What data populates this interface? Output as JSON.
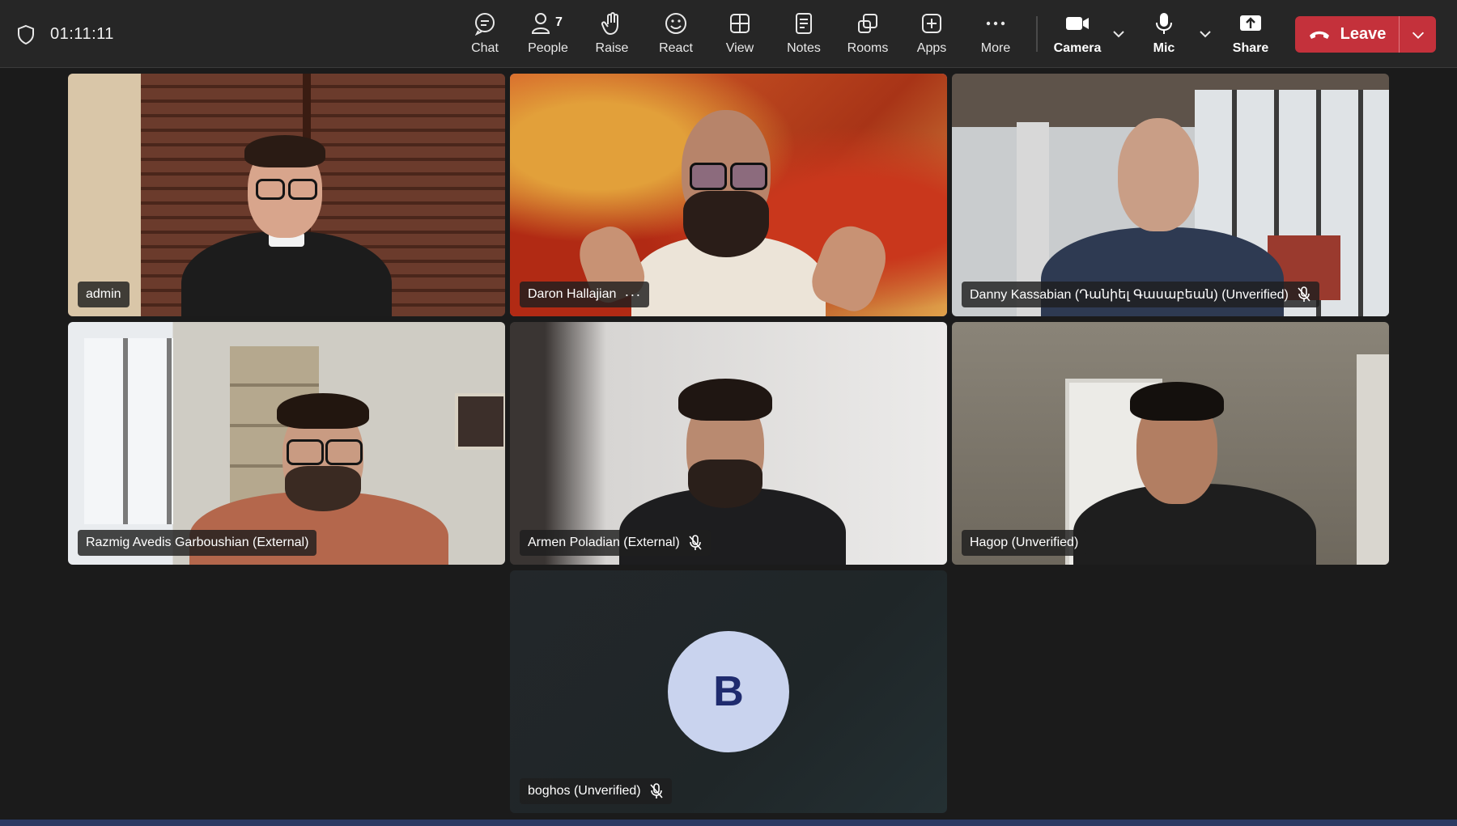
{
  "meeting": {
    "timer": "01:11:11"
  },
  "toolbar": {
    "chat": "Chat",
    "people": "People",
    "people_count": "7",
    "raise": "Raise",
    "react": "React",
    "view": "View",
    "notes": "Notes",
    "rooms": "Rooms",
    "apps": "Apps",
    "more": "More",
    "camera": "Camera",
    "mic": "Mic",
    "share": "Share",
    "leave": "Leave"
  },
  "participants": [
    {
      "name": "admin",
      "muted": false
    },
    {
      "name": "Daron Hallajian",
      "muted": false,
      "active_speaker": true,
      "more_options": "···"
    },
    {
      "name": "Danny Kassabian (Դանիել Գասաբեան) (Unverified)",
      "muted": true
    },
    {
      "name": "Razmig Avedis Garboushian (External)",
      "muted": false
    },
    {
      "name": "Armen Poladian (External)",
      "muted": true
    },
    {
      "name": "Hagop (Unverified)",
      "muted": false
    },
    {
      "name": "boghos (Unverified)",
      "muted": true,
      "avatar_initial": "B"
    }
  ],
  "colors": {
    "background": "#1b1b1b",
    "toolbar": "#262626",
    "leave_button": "#c4313b",
    "active_speaker_border": "#7f85f5",
    "avatar_bg": "#c9d3ee",
    "avatar_text": "#1f2b6e"
  }
}
